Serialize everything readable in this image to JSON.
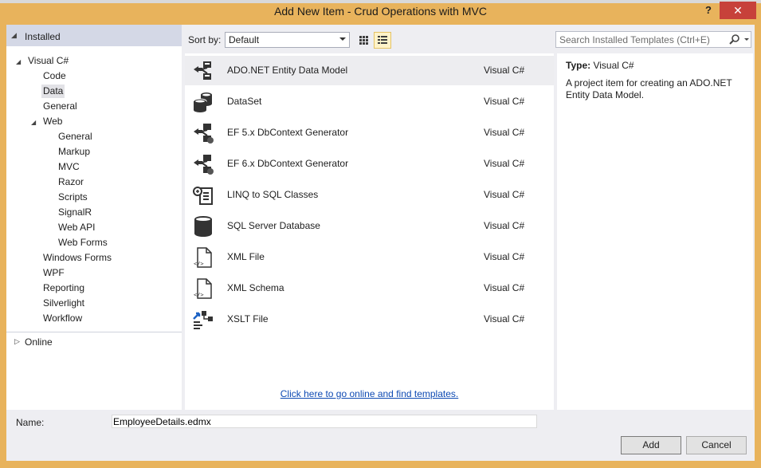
{
  "window": {
    "title": "Add New Item - Crud Operations with MVC",
    "help_label": "?",
    "close_label": "✕"
  },
  "tree": {
    "installed_label": "Installed",
    "items": [
      {
        "label": "Visual C#"
      },
      {
        "label": "Code"
      },
      {
        "label": "Data"
      },
      {
        "label": "General"
      },
      {
        "label": "Web"
      },
      {
        "label": "General"
      },
      {
        "label": "Markup"
      },
      {
        "label": "MVC"
      },
      {
        "label": "Razor"
      },
      {
        "label": "Scripts"
      },
      {
        "label": "SignalR"
      },
      {
        "label": "Web API"
      },
      {
        "label": "Web Forms"
      },
      {
        "label": "Windows Forms"
      },
      {
        "label": "WPF"
      },
      {
        "label": "Reporting"
      },
      {
        "label": "Silverlight"
      },
      {
        "label": "Workflow"
      }
    ],
    "selected_item": "Data",
    "online_label": "Online"
  },
  "toolbar": {
    "sort_label": "Sort by:",
    "sort_value": "Default",
    "search_placeholder": "Search Installed Templates (Ctrl+E)"
  },
  "templates": [
    {
      "name": "ADO.NET Entity Data Model",
      "lang": "Visual C#",
      "icon": "entity-model-icon"
    },
    {
      "name": "DataSet",
      "lang": "Visual C#",
      "icon": "dataset-icon"
    },
    {
      "name": "EF 5.x DbContext Generator",
      "lang": "Visual C#",
      "icon": "dbcontext-generator-icon"
    },
    {
      "name": "EF 6.x DbContext Generator",
      "lang": "Visual C#",
      "icon": "dbcontext-generator-icon"
    },
    {
      "name": "LINQ to SQL Classes",
      "lang": "Visual C#",
      "icon": "linq-to-sql-icon"
    },
    {
      "name": "SQL Server Database",
      "lang": "Visual C#",
      "icon": "database-icon"
    },
    {
      "name": "XML File",
      "lang": "Visual C#",
      "icon": "xml-file-icon"
    },
    {
      "name": "XML Schema",
      "lang": "Visual C#",
      "icon": "xml-schema-icon"
    },
    {
      "name": "XSLT File",
      "lang": "Visual C#",
      "icon": "xslt-file-icon"
    }
  ],
  "online_link": "Click here to go online and find templates.",
  "description": {
    "type_label": "Type:",
    "type_value": "Visual C#",
    "text": "A project item for creating an ADO.NET Entity Data Model."
  },
  "footer": {
    "name_label": "Name:",
    "name_value": "EmployeeDetails.edmx",
    "add_label": "Add",
    "cancel_label": "Cancel"
  },
  "colors": {
    "frame": "#e8b35c",
    "close": "#c7413a",
    "header": "#d4d8e6",
    "link": "#0e4ab3"
  }
}
